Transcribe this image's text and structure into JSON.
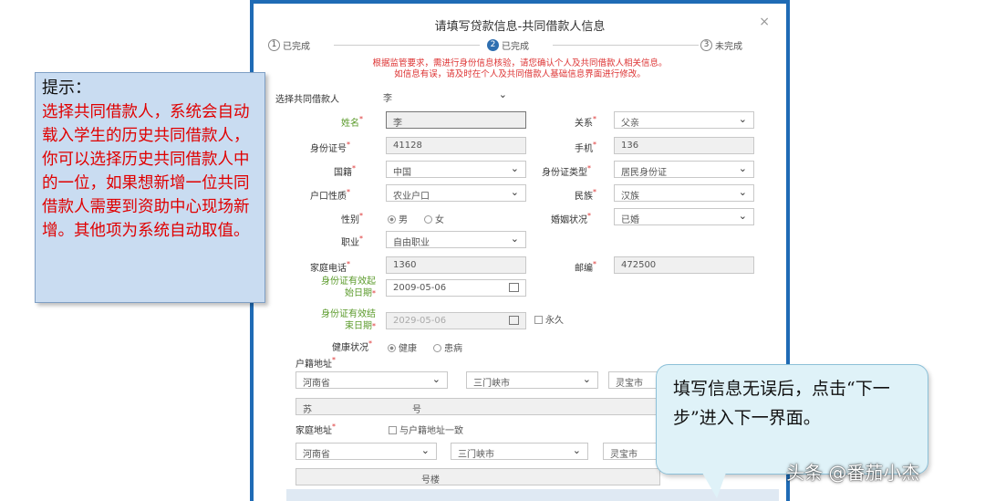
{
  "dialog": {
    "title": "请填写贷款信息-共同借款人信息",
    "close": "×",
    "steps": [
      {
        "num": "1",
        "label": "已完成"
      },
      {
        "num": "2",
        "label": "已完成"
      },
      {
        "num": "3",
        "label": "未完成"
      }
    ],
    "notice_line1": "根据监管要求，需进行身份信息核验，请您确认个人及共同借款人相关信息。",
    "notice_line2": "如信息有误，请及时在个人及共同借款人基础信息界面进行修改。"
  },
  "form": {
    "select_coborrower": {
      "label": "选择共同借款人",
      "value": "李"
    },
    "name": {
      "label": "姓名",
      "value": "李"
    },
    "relation": {
      "label": "关系",
      "value": "父亲"
    },
    "id_number": {
      "label": "身份证号",
      "value": "41128"
    },
    "phone": {
      "label": "手机",
      "value": "136"
    },
    "nationality": {
      "label": "国籍",
      "value": "中国"
    },
    "id_type": {
      "label": "身份证类型",
      "value": "居民身份证"
    },
    "household_type": {
      "label": "户口性质",
      "value": "农业户口"
    },
    "ethnicity": {
      "label": "民族",
      "value": "汉族"
    },
    "gender": {
      "label": "性别",
      "male": "男",
      "female": "女",
      "selected": "男"
    },
    "marital": {
      "label": "婚姻状况",
      "value": "已婚"
    },
    "occupation": {
      "label": "职业",
      "value": "自由职业"
    },
    "home_phone": {
      "label": "家庭电话",
      "value": "1360"
    },
    "postcode": {
      "label": "邮编",
      "value": "472500"
    },
    "id_start": {
      "label_line1": "身份证有效起",
      "label_line2": "始日期",
      "value": "2009-05-06"
    },
    "id_end": {
      "label_line1": "身份证有效结",
      "label_line2": "束日期",
      "value": "2029-05-06",
      "permanent": "永久"
    },
    "health": {
      "label": "健康状况",
      "healthy": "健康",
      "ill": "患病",
      "selected": "健康"
    },
    "household_addr": {
      "label": "户籍地址",
      "province": "河南省",
      "city": "三门峡市",
      "county": "灵宝市",
      "detail_start": "苏",
      "detail_end": "号"
    },
    "home_addr": {
      "label": "家庭地址",
      "same_as": "与户籍地址一致",
      "province": "河南省",
      "city": "三门峡市",
      "county": "灵宝市",
      "detail_end": "号楼"
    }
  },
  "tips": {
    "left_head": "提示：",
    "left_body": "选择共同借款人，系统会自动载入学生的历史共同借款人，你可以选择历史共同借款人中的一位，如果想新增一位共同借款人需要到资助中心现场新增。其他项为系统自动取值。",
    "right_body": "填写信息无误后，点击“下一步”进入下一界面。"
  },
  "watermark": "头条 @番茄小杰"
}
